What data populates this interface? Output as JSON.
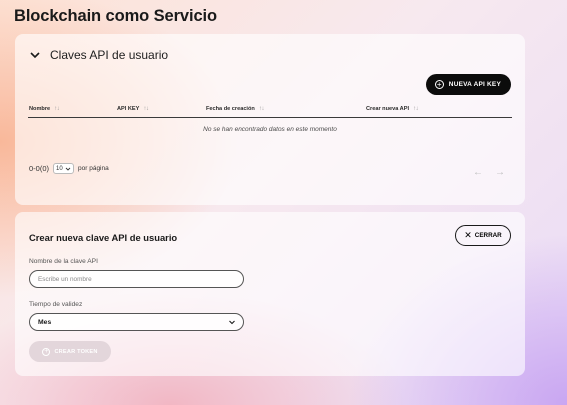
{
  "page": {
    "title": "Blockchain como Servicio"
  },
  "api_keys": {
    "section_title": "Claves API de usuario",
    "new_button_label": "NUEVA API KEY",
    "columns": [
      {
        "label": "Nombre"
      },
      {
        "label": "API KEY"
      },
      {
        "label": "Fecha de creación"
      },
      {
        "label": "Crear nueva API"
      }
    ],
    "empty_message": "No se han encontrado datos en este momento",
    "pagination": {
      "count": "0-0(0)",
      "page_size": "10",
      "per_page_label": "por página",
      "prev": "←",
      "next": "→"
    }
  },
  "create_form": {
    "title": "Crear nueva clave API de usuario",
    "close_label": "CERRAR",
    "name_label": "Nombre de la clave API",
    "name_placeholder": "Escribe un nombre",
    "validity_label": "Tiempo de validez",
    "validity_value": "Mes",
    "submit_label": "CREAR TOKEN"
  },
  "icons": {
    "collapse": "chevron-down-icon",
    "add": "plus-circle-icon",
    "close": "close-icon",
    "sort": "sort-icon",
    "dropdown": "chevron-down-icon"
  }
}
